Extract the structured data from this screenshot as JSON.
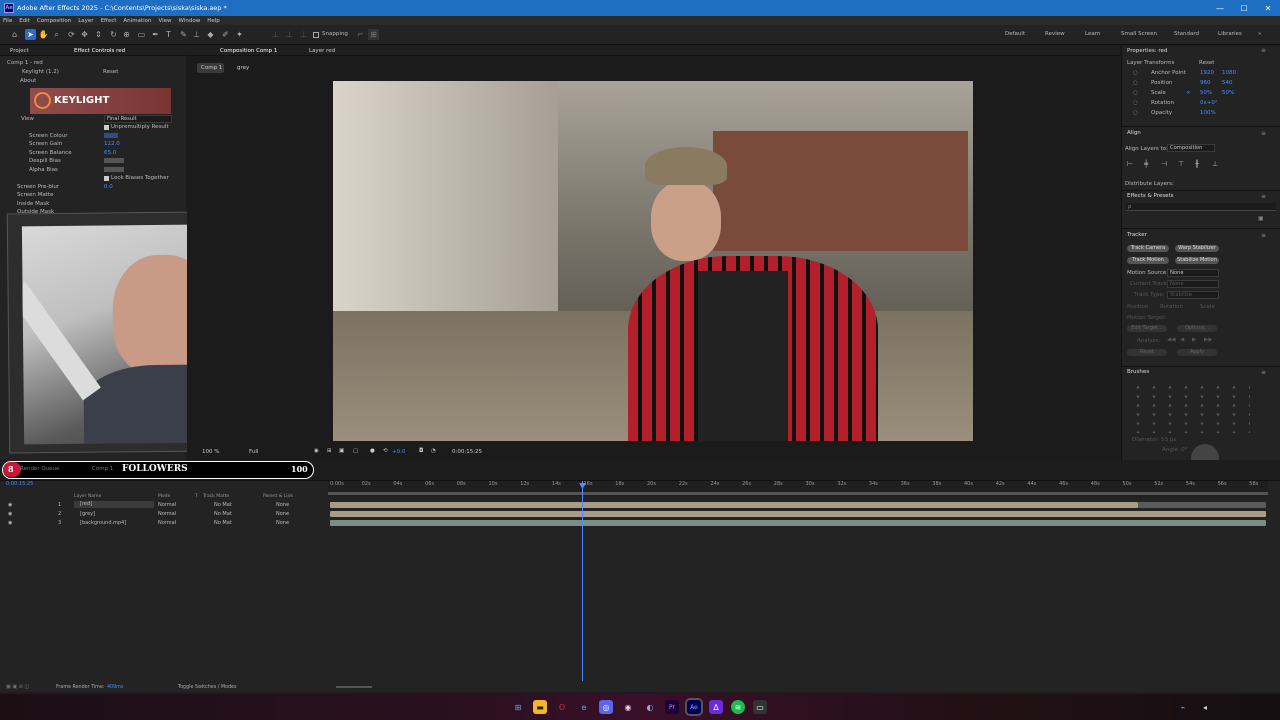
{
  "window": {
    "title": "Adobe After Effects 2025 - C:\\Contents\\Projects\\siska\\siska.aep *",
    "app_badge": "Ae",
    "minimize": "—",
    "maximize": "☐",
    "close": "✕"
  },
  "menu": [
    "File",
    "Edit",
    "Composition",
    "Layer",
    "Effect",
    "Animation",
    "View",
    "Window",
    "Help"
  ],
  "toolbar": {
    "snapping_label": "Snapping",
    "workspaces": [
      "Default",
      "Review",
      "Learn",
      "Small Screen",
      "Standard",
      "Libraries"
    ]
  },
  "left_panel": {
    "tabs": [
      "Project",
      "Effect Controls red"
    ],
    "comp_path": "Comp 1 - red",
    "effect_name": "Keylight (1.2)",
    "effect_reset": "Reset",
    "about": "About",
    "logo_text": "KEYLIGHT",
    "view_label": "View",
    "view_value": "Final Result",
    "unpremultiply": "Unpremultiply Result",
    "props": [
      {
        "label": "Screen Colour",
        "value": ""
      },
      {
        "label": "Screen Gain",
        "value": "122.0"
      },
      {
        "label": "Screen Balance",
        "value": "65.0"
      },
      {
        "label": "Despill Bias",
        "value": ""
      },
      {
        "label": "Alpha Bias",
        "value": ""
      }
    ],
    "lock_biases": "Lock Biases Together",
    "screen_preblur": "Screen Pre-blur",
    "preblur_value": "0.0",
    "groups": [
      "Screen Matte",
      "Inside Mask",
      "Outside Mask"
    ]
  },
  "viewer": {
    "tabs": [
      "Composition Comp 1",
      "Layer red"
    ],
    "breadcrumb": [
      "Comp 1",
      "grey"
    ],
    "zoom": "100 %",
    "resolution": "Full",
    "timecode": "0:00:15:25",
    "exposure": "+0.0"
  },
  "overlay": {
    "count_left": "8",
    "followers": "FOLLOWERS",
    "count_right": "100"
  },
  "right_panel": {
    "properties_title": "Properties: red",
    "layer_transforms": "Layer Transforms",
    "reset": "Reset",
    "transforms": [
      {
        "label": "Anchor Point",
        "v1": "1920",
        "v2": "1080"
      },
      {
        "label": "Position",
        "v1": "960",
        "v2": "540"
      },
      {
        "label": "Scale",
        "v1": "50%",
        "v2": "50%"
      },
      {
        "label": "Rotation",
        "v1": "0x+0°",
        "v2": ""
      },
      {
        "label": "Opacity",
        "v1": "100%",
        "v2": ""
      }
    ],
    "align": "Align",
    "align_to_label": "Align Layers to:",
    "align_to_value": "Composition",
    "distribute": "Distribute Layers:",
    "effects_presets": "Effects & Presets",
    "search_placeholder": "ρ",
    "tracker": "Tracker",
    "tracker_buttons": [
      "Track Camera",
      "Warp Stabilizer",
      "Track Motion",
      "Stabilize Motion"
    ],
    "motion_source_label": "Motion Source:",
    "motion_source_value": "None",
    "current_track_label": "Current Track:",
    "current_track_value": "None",
    "track_type_label": "Track Type:",
    "track_type_value": "Stabilize",
    "checks": [
      "Position",
      "Rotation",
      "Scale"
    ],
    "motion_target": "Motion Target:",
    "edit_target": "Edit Target...",
    "options": "Options...",
    "analyze": "Analyze:",
    "reset_btn": "Reset",
    "apply_btn": "Apply",
    "brushes": "Brushes",
    "diameter": "Diameter: 53 px",
    "angle": "Angle: 0°"
  },
  "timeline": {
    "tabs": [
      "Render Queue",
      "Comp 1"
    ],
    "timecode": "0:00:15:25",
    "columns": [
      "Layer Name",
      "Mode",
      "T",
      "Track Matte",
      "Parent & Link"
    ],
    "layers": [
      {
        "num": "1",
        "name": "[red]",
        "mode": "Normal",
        "matte": "No Mat",
        "parent": "None"
      },
      {
        "num": "2",
        "name": "[grey]",
        "mode": "Normal",
        "matte": "No Mat",
        "parent": "None"
      },
      {
        "num": "3",
        "name": "[background.mp4]",
        "mode": "Normal",
        "matte": "No Mat",
        "parent": "None"
      }
    ],
    "ruler": [
      "0:00s",
      "02s",
      "04s",
      "06s",
      "08s",
      "10s",
      "12s",
      "14s",
      "16s",
      "18s",
      "20s",
      "22s",
      "24s",
      "26s",
      "28s",
      "30s",
      "32s",
      "34s",
      "36s",
      "38s",
      "40s",
      "42s",
      "44s",
      "46s",
      "48s",
      "50s",
      "52s",
      "54s",
      "56s",
      "58s"
    ],
    "render_time_label": "Frame Render Time:",
    "render_time_value": "409ms",
    "toggle": "Toggle Switches / Modes"
  },
  "taskbar": {
    "icons": [
      "windows-icon",
      "file-explorer-icon",
      "opera-icon",
      "edge-icon",
      "discord-icon",
      "chrome-icon",
      "steam-icon",
      "premiere-icon",
      "after-effects-icon",
      "affinity-icon",
      "spotify-icon",
      "terminal-icon"
    ]
  },
  "colors": {
    "accent": "#2d6bd3",
    "titlebar": "#1e6fc4",
    "value_blue": "#4b8dff",
    "playhead": "#4b8dff"
  }
}
